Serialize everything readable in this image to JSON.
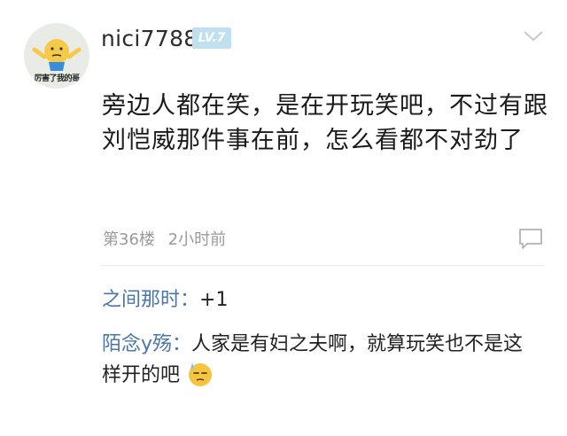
{
  "post": {
    "username": "nici7788",
    "level_badge": "LV.7",
    "avatar_caption": "厉害了我的哥",
    "text": "旁边人都在笑，是在开玩笑吧，不过有跟刘恺威那件事在前，怎么看都不对劲了",
    "floor": "第36楼",
    "time": "2小时前"
  },
  "replies": [
    {
      "author": "之间那时：",
      "text": "+1"
    },
    {
      "author": "陌念y殇：",
      "text": "人家是有妇之夫啊，就算玩笑也不是这样开的吧",
      "emoji": "sweat-emoji"
    }
  ],
  "icons": {
    "menu": "chevron-down-icon",
    "comment": "comment-icon"
  },
  "colors": {
    "author_blue": "#4a77a8",
    "badge": "#bfe0f1",
    "meta_gray": "#9a9a9a"
  }
}
